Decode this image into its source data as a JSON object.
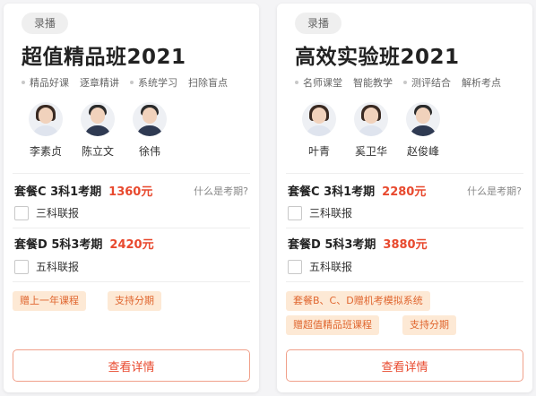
{
  "cards": [
    {
      "tag": "录播",
      "title": "超值精品班2021",
      "features": [
        "精品好课",
        "逐章精讲",
        "系统学习",
        "扫除盲点"
      ],
      "teachers": [
        {
          "name": "李素贞",
          "gender": "female"
        },
        {
          "name": "陈立文",
          "gender": "male"
        },
        {
          "name": "徐伟",
          "gender": "male"
        }
      ],
      "plans": [
        {
          "name": "套餐C 3科1考期",
          "price": "1360元",
          "help": "什么是考期?",
          "option": "三科联报"
        },
        {
          "name": "套餐D 5科3考期",
          "price": "2420元",
          "help": "",
          "option": "五科联报"
        }
      ],
      "badges": [
        "赠上一年课程",
        "支持分期"
      ],
      "detail_button": "查看详情"
    },
    {
      "tag": "录播",
      "title": "高效实验班2021",
      "features": [
        "名师课堂",
        "智能教学",
        "测评结合",
        "解析考点"
      ],
      "teachers": [
        {
          "name": "叶青",
          "gender": "female"
        },
        {
          "name": "奚卫华",
          "gender": "female"
        },
        {
          "name": "赵俊峰",
          "gender": "male"
        }
      ],
      "plans": [
        {
          "name": "套餐C 3科1考期",
          "price": "2280元",
          "help": "什么是考期?",
          "option": "三科联报"
        },
        {
          "name": "套餐D 5科3考期",
          "price": "3880元",
          "help": "",
          "option": "五科联报"
        }
      ],
      "badges": [
        "套餐B、C、D赠机考模拟系统",
        "赠超值精品班课程",
        "支持分期"
      ],
      "detail_button": "查看详情"
    }
  ],
  "colors": {
    "accent": "#e8492e",
    "badge_bg": "#fde9d5",
    "badge_text": "#e0662f"
  }
}
